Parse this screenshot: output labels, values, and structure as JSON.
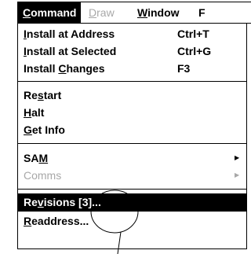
{
  "menubar": {
    "items": [
      {
        "label": "Command",
        "mnemonic": 0,
        "state": "selected"
      },
      {
        "label": "Draw",
        "mnemonic": 0,
        "state": "disabled"
      },
      {
        "label": "Window",
        "mnemonic": 0,
        "state": "normal"
      },
      {
        "label": "F",
        "mnemonic": -1,
        "state": "normal"
      }
    ]
  },
  "menu": {
    "items": [
      {
        "label": "Install at Address",
        "mnemonic": 0,
        "shortcut": "Ctrl+T"
      },
      {
        "label": "Install at Selected",
        "mnemonic": 0,
        "shortcut": "Ctrl+G"
      },
      {
        "label": "Install Changes",
        "mnemonic": 8,
        "shortcut": "F3"
      },
      {
        "label": "Restart",
        "mnemonic": 2
      },
      {
        "label": "Halt",
        "mnemonic": 0
      },
      {
        "label": "Get Info",
        "mnemonic": 0
      },
      {
        "label": "SAM",
        "mnemonic": 2,
        "submenu": true
      },
      {
        "label": "Comms",
        "mnemonic": -1,
        "submenu": true,
        "disabled": true
      },
      {
        "label": "Revisions [3]...",
        "mnemonic": 2,
        "highlighted": true
      },
      {
        "label": "Readdress...",
        "mnemonic": 0
      }
    ]
  },
  "icons": {
    "submenu_arrow": "triangle-right-icon"
  }
}
